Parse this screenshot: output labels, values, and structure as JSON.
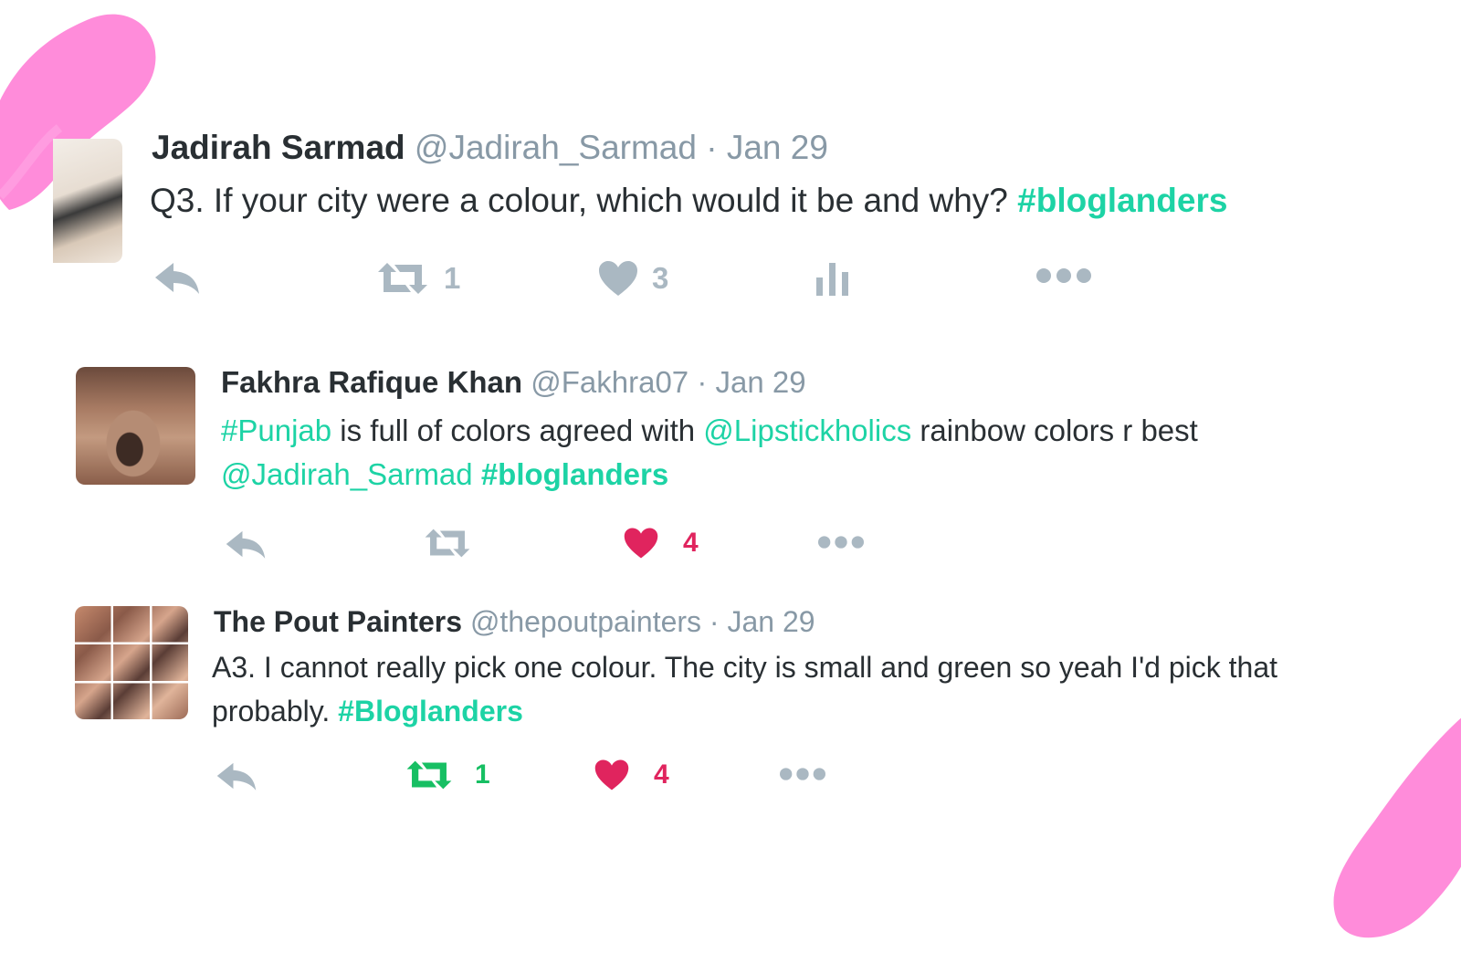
{
  "colors": {
    "accent": "#1dd3a5",
    "like": "#e0245e",
    "retweet": "#17bf63",
    "icon": "#aab8c2",
    "splash": "#ff7fd6"
  },
  "tweets": [
    {
      "name": "Jadirah  Sarmad",
      "handle": "@Jadirah_Sarmad",
      "date": "· Jan 29",
      "text_plain": "Q3. If your city were a colour, which would it be and why? ",
      "hashtag": "#bloglanders",
      "retweet_count": "1",
      "like_count": "3",
      "icons": [
        "reply-icon",
        "retweet-icon",
        "heart-icon",
        "analytics-icon",
        "more-icon"
      ]
    },
    {
      "name": "Fakhra Rafique Khan",
      "handle": "@Fakhra07",
      "date": "· Jan 29",
      "tag_punjab": "#Punjab",
      "text_1": " is full of colors agreed with ",
      "mention_lipstick": "@Lipstickholics",
      "text_2": " rainbow colors r best",
      "mention_jadirah": "@Jadirah_Sarmad",
      "hashtag": "#bloglanders",
      "like_count": "4",
      "icons": [
        "reply-icon",
        "retweet-icon",
        "heart-icon",
        "more-icon"
      ]
    },
    {
      "name": "The Pout Painters",
      "handle": "@thepoutpainters",
      "date": "· Jan 29",
      "text_plain": "A3. I cannot really pick one colour. The city is small and green so yeah I'd pick that probably. ",
      "hashtag": "#Bloglanders",
      "retweet_count": "1",
      "like_count": "4",
      "icons": [
        "reply-icon",
        "retweet-icon",
        "heart-icon",
        "more-icon"
      ]
    }
  ]
}
